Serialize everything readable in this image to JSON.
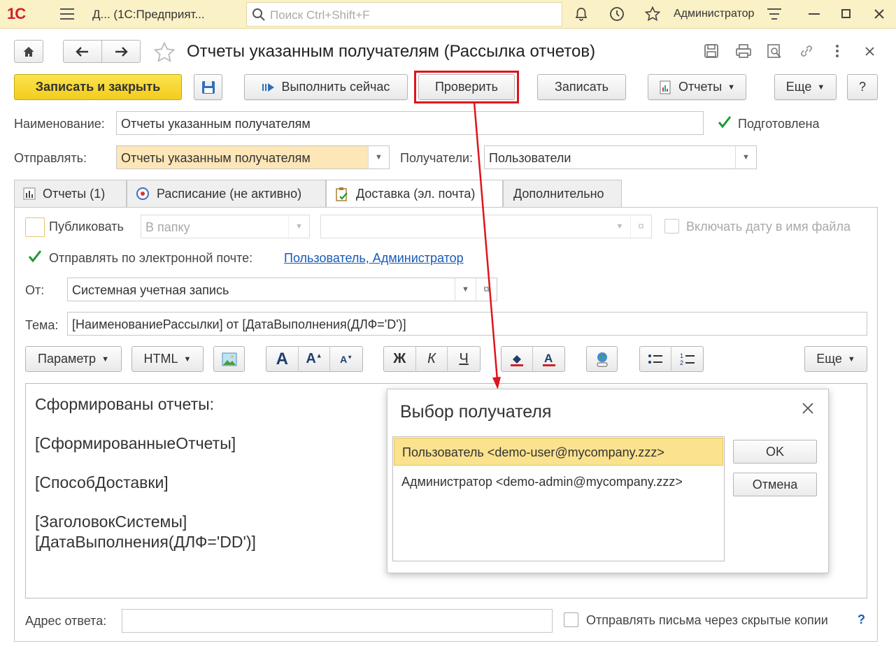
{
  "topbar": {
    "logo": "1С",
    "app_title": "Д...  (1С:Предприят...",
    "search_placeholder": "Поиск Ctrl+Shift+F",
    "user": "Администратор"
  },
  "window": {
    "title": "Отчеты указанным получателям (Рассылка отчетов)"
  },
  "toolbar": {
    "save_close": "Записать и закрыть",
    "run_now": "Выполнить сейчас",
    "check": "Проверить",
    "save": "Записать",
    "reports": "Отчеты",
    "more": "Еще",
    "help": "?"
  },
  "form": {
    "name_label": "Наименование:",
    "name_value": "Отчеты указанным получателям",
    "prepared_label": "Подготовлена",
    "prepared_checked": true,
    "send_label": "Отправлять:",
    "send_value": "Отчеты указанным получателям",
    "recipients_label": "Получатели:",
    "recipients_value": "Пользователи"
  },
  "tabs": [
    {
      "label": "Отчеты (1)",
      "icon": "chart-icon",
      "active": false
    },
    {
      "label": "Расписание (не активно)",
      "icon": "clock-icon",
      "active": false
    },
    {
      "label": "Доставка (эл. почта)",
      "icon": "clipboard-check-icon",
      "active": true
    },
    {
      "label": "Дополнительно",
      "icon": "",
      "active": false
    }
  ],
  "delivery": {
    "publish_label": "Публиковать",
    "publish_checked": false,
    "folder_value": "В папку",
    "include_date_label": "Включать дату в имя файла",
    "email_label": "Отправлять по электронной почте:",
    "email_checked": true,
    "email_link": "Пользователь, Администратор",
    "from_label": "От:",
    "from_value": "Системная учетная запись",
    "subject_label": "Тема:",
    "subject_value": "[НаименованиеРассылки] от [ДатаВыполнения(ДЛФ='D')]",
    "param_btn": "Параметр",
    "html_btn": "HTML",
    "bold": "Ж",
    "italic": "К",
    "underline": "Ч",
    "more_btn": "Еще",
    "body_lines": [
      "Сформированы отчеты:",
      "[СформированныеОтчеты]",
      "[СпособДоставки]",
      "[ЗаголовокСистемы]",
      "[ДатаВыполнения(ДЛФ='DD')]"
    ],
    "reply_label": "Адрес ответа:",
    "reply_value": "",
    "bcc_label": "Отправлять письма через скрытые копии",
    "bcc_checked": false,
    "help": "?"
  },
  "dialog": {
    "title": "Выбор получателя",
    "items": [
      {
        "label": "Пользователь <demo-user@mycompany.zzz>",
        "selected": true
      },
      {
        "label": "Администратор <demo-admin@mycompany.zzz>",
        "selected": false
      }
    ],
    "ok": "OK",
    "cancel": "Отмена"
  },
  "colors": {
    "topbar_bg": "#fbf1c6",
    "primary_button": "#f4cd1d",
    "highlight_red": "#e0141c",
    "selected_row": "#fbe28e",
    "link": "#1a5ab5",
    "check_green": "#1c9a36"
  }
}
